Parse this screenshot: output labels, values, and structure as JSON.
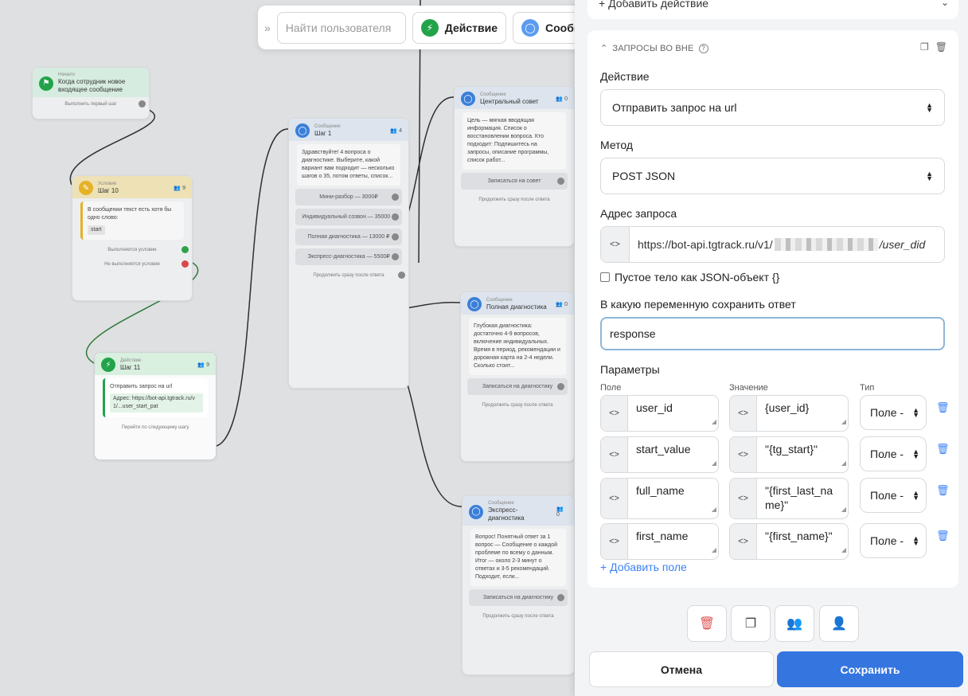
{
  "toolbar": {
    "search_placeholder": "Найти пользователя",
    "action_label": "Действие",
    "message_label": "Сообщение"
  },
  "canvas": {
    "nodes": [
      {
        "sub": "Начало",
        "title": "Когда сотрудник новое входящее сообщение",
        "foot": "Выполнить первый шаг",
        "accent": "#22a34a"
      },
      {
        "sub": "Условие",
        "title": "Шаг 10",
        "count": "9",
        "body": "В сообщении текст есть хотя бы одно слово:",
        "tag": "start",
        "btn1": "Выполняется условие",
        "btn2": "Не выполняется условие",
        "accent": "#e5b227"
      },
      {
        "sub": "Действие",
        "title": "Шаг 11",
        "count": "9",
        "body": "Отправить запрос на url",
        "code": "Адрес: https://bot-api.tgtrack.ru/v1/...user_start_pat",
        "foot": "Перейти по следующему шагу",
        "accent": "#22a34a"
      },
      {
        "sub": "Сообщение",
        "title": "Шаг 1",
        "count": "4",
        "body": "Здравствуйте! 4 вопроса о диагностике. Выберите, какой вариант вам подходит — несколько шагов о 35, потом ответы, список...",
        "btns": [
          "Мини-разбор — 3000₽",
          "Индивидуальный созвон — 35000 ₽",
          "Полная диагностика — 13000 ₽",
          "Экспресс-диагностика — 5500₽"
        ],
        "foot": "Продолжить сразу после ответа",
        "accent": "#3b7fd9"
      },
      {
        "sub": "Сообщение",
        "title": "Центральный совет",
        "count": "0",
        "body": "Цель — мягкая вводящая информация. Список о восстановлении вопроса. Кто подходит: Подпишитесь на запросы, описание программы, список работ...",
        "btns": [
          "Записаться на совет"
        ],
        "foot": "Продолжить сразу после ответа",
        "accent": "#3b7fd9"
      },
      {
        "sub": "Сообщение",
        "title": "Полная диагностика",
        "count": "0",
        "body": "Глубокая диагностика: достаточно 4-9 вопросов, включение индивидуальных. Время в период, рекомендации и дорожная карта на 2-4 недели. Сколько стоит...",
        "btns": [
          "Записаться на диагностику"
        ],
        "foot": "Продолжить сразу после ответа",
        "accent": "#3b7fd9"
      },
      {
        "sub": "Сообщение",
        "title": "Экспресс-диагностика",
        "count": "0",
        "body": "Вопрос! Понятный ответ за 1 вопрос — Сообщение о каждой проблеме по всему о данным. Итог — около 2-3 минут о ответах и 3-5 рекомендаций. Подходит, если...",
        "btns": [
          "Записаться на диагностику"
        ],
        "foot": "Продолжить сразу после ответа",
        "accent": "#3b7fd9"
      }
    ]
  },
  "panel": {
    "add_action_label": "+ Добавить действие",
    "section_title": "ЗАПРОСЫ ВО ВНЕ",
    "action_label": "Действие",
    "action_value": "Отправить запрос на url",
    "method_label": "Метод",
    "method_value": "POST JSON",
    "url_label": "Адрес запроса",
    "url_prefix": "https://bot-api.tgtrack.ru/v1/",
    "url_suffix": "/user_did",
    "empty_body_label": "Пустое тело как JSON-объект {}",
    "save_var_label": "В какую переменную сохранить ответ",
    "save_var_value": "response",
    "params_label": "Параметры",
    "col_field": "Поле",
    "col_value": "Значение",
    "col_type": "Тип",
    "params": [
      {
        "field": "user_id",
        "value": "{user_id}",
        "type": "Поле -"
      },
      {
        "field": "start_value",
        "value": "\"{tg_start}\"",
        "type": "Поле -"
      },
      {
        "field": "full_name",
        "value": "\"{first_last_name}\"",
        "type": "Поле -"
      },
      {
        "field": "first_name",
        "value": "\"{first_name}\"",
        "type": "Поле -"
      }
    ],
    "add_field_label": "+ Добавить поле",
    "cancel_label": "Отмена",
    "save_label": "Сохранить"
  },
  "colors": {
    "accent": "#3475e0",
    "green": "#22a34a",
    "yellow": "#e5b227",
    "blue_node": "#3b7fd9",
    "delete": "#3b82f6"
  }
}
